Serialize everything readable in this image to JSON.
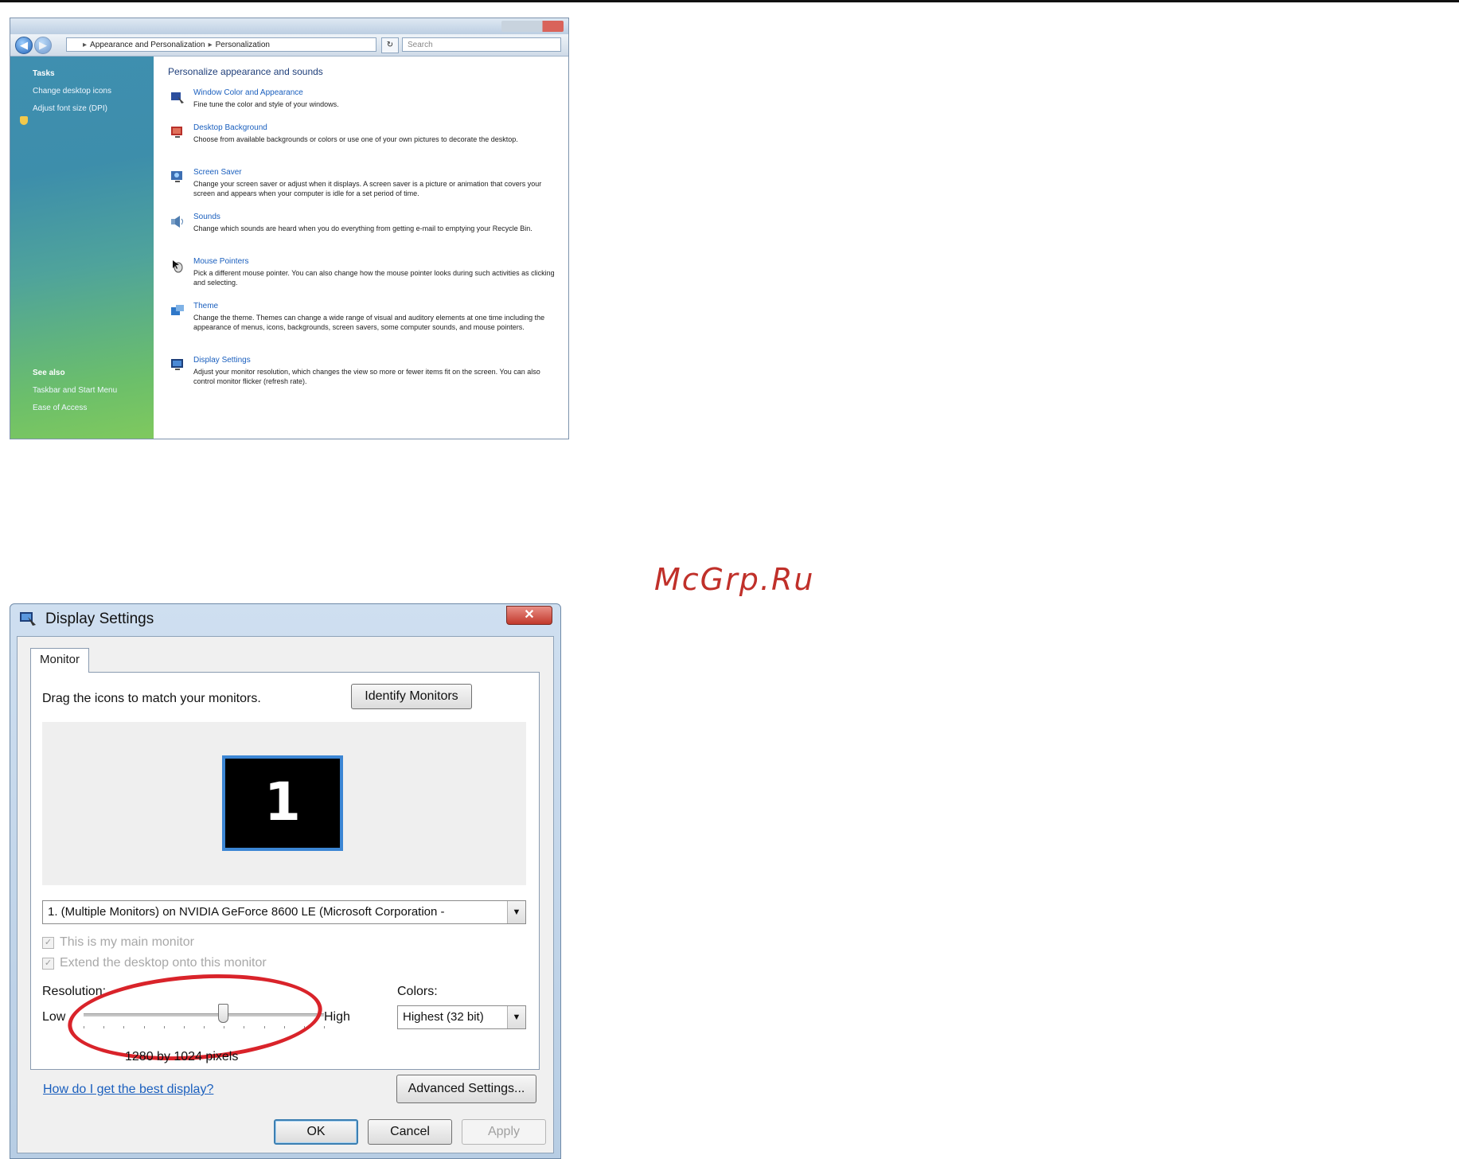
{
  "watermark": "McGrp.Ru",
  "personalization": {
    "address": {
      "crumb1": "Appearance and Personalization",
      "crumb2": "Personalization",
      "search_placeholder": "Search"
    },
    "sidebar": {
      "tasks_heading": "Tasks",
      "tasks": [
        "Change desktop icons",
        "Adjust font size (DPI)"
      ],
      "see_also_heading": "See also",
      "see_also": [
        "Taskbar and Start Menu",
        "Ease of Access"
      ]
    },
    "heading": "Personalize appearance and sounds",
    "items": [
      {
        "title": "Window Color and Appearance",
        "desc": "Fine tune the color and style of your windows."
      },
      {
        "title": "Desktop Background",
        "desc": "Choose from available backgrounds or colors or use one of your own pictures to decorate the desktop."
      },
      {
        "title": "Screen Saver",
        "desc": "Change your screen saver or adjust when it displays. A screen saver is a picture or animation that covers your screen and appears when your computer is idle for a set period of time."
      },
      {
        "title": "Sounds",
        "desc": "Change which sounds are heard when you do everything from getting e-mail to emptying your Recycle Bin."
      },
      {
        "title": "Mouse Pointers",
        "desc": "Pick a different mouse pointer. You can also change how the mouse pointer looks during such activities as clicking and selecting."
      },
      {
        "title": "Theme",
        "desc": "Change the theme. Themes can change a wide range of visual and auditory elements at one time including the appearance of menus, icons, backgrounds, screen savers, some computer sounds, and mouse pointers."
      },
      {
        "title": "Display Settings",
        "desc": "Adjust your monitor resolution, which changes the view so more or fewer items fit on the screen. You can also control monitor flicker (refresh rate)."
      }
    ]
  },
  "display_settings": {
    "title": "Display Settings",
    "close_glyph": "✕",
    "tab": "Monitor",
    "instruction": "Drag the icons to match your monitors.",
    "identify_button": "Identify Monitors",
    "monitor_number": "1",
    "monitor_select": "1. (Multiple Monitors) on NVIDIA GeForce 8600 LE (Microsoft Corporation -",
    "main_monitor": {
      "label": "This is my main monitor",
      "checked": true
    },
    "extend_desktop": {
      "label": "Extend the desktop onto this monitor",
      "checked": true
    },
    "resolution": {
      "label": "Resolution:",
      "low": "Low",
      "high": "High",
      "value_text": "1280 by 1024 pixels",
      "slider_fraction": 0.58
    },
    "colors": {
      "label": "Colors:",
      "selected": "Highest (32 bit)"
    },
    "help_link": "How do I get the best display?",
    "advanced_button": "Advanced Settings...",
    "ok_button": "OK",
    "cancel_button": "Cancel",
    "apply_button": "Apply"
  }
}
